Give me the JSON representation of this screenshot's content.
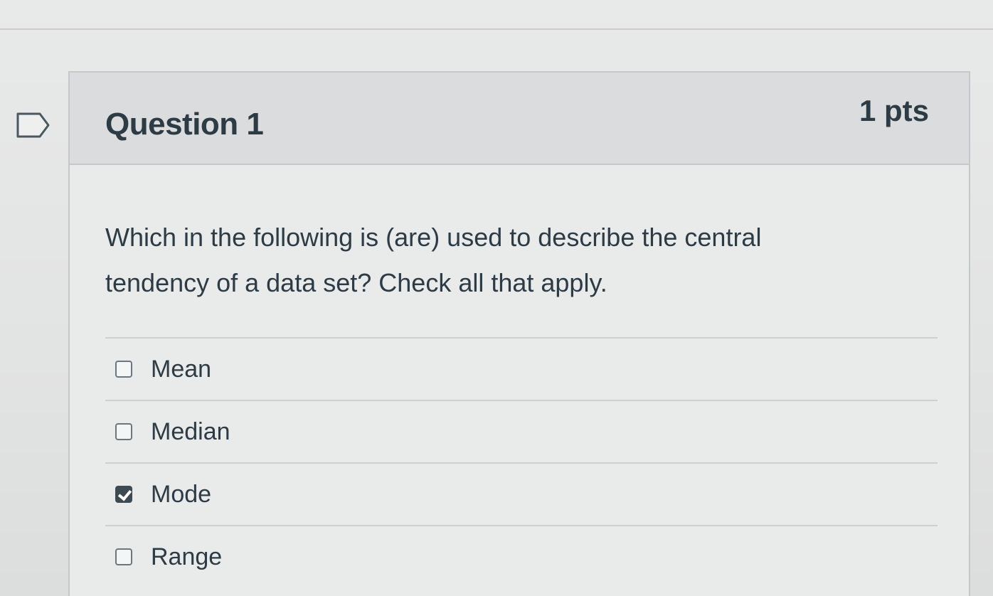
{
  "question": {
    "title": "Question 1",
    "points": "1 pts",
    "text": "Which in the following is (are) used to describe the central tendency of a data set? Check all that apply."
  },
  "answers": [
    {
      "label": "Mean",
      "checked": false
    },
    {
      "label": "Median",
      "checked": false
    },
    {
      "label": "Mode",
      "checked": true
    },
    {
      "label": "Range",
      "checked": false
    }
  ],
  "icons": {
    "flag": "flag-question-icon",
    "check": "checkmark-icon"
  },
  "colors": {
    "text": "#2d3b45",
    "header_bg": "#dadcdd",
    "checked_box": "#3d4a52"
  }
}
